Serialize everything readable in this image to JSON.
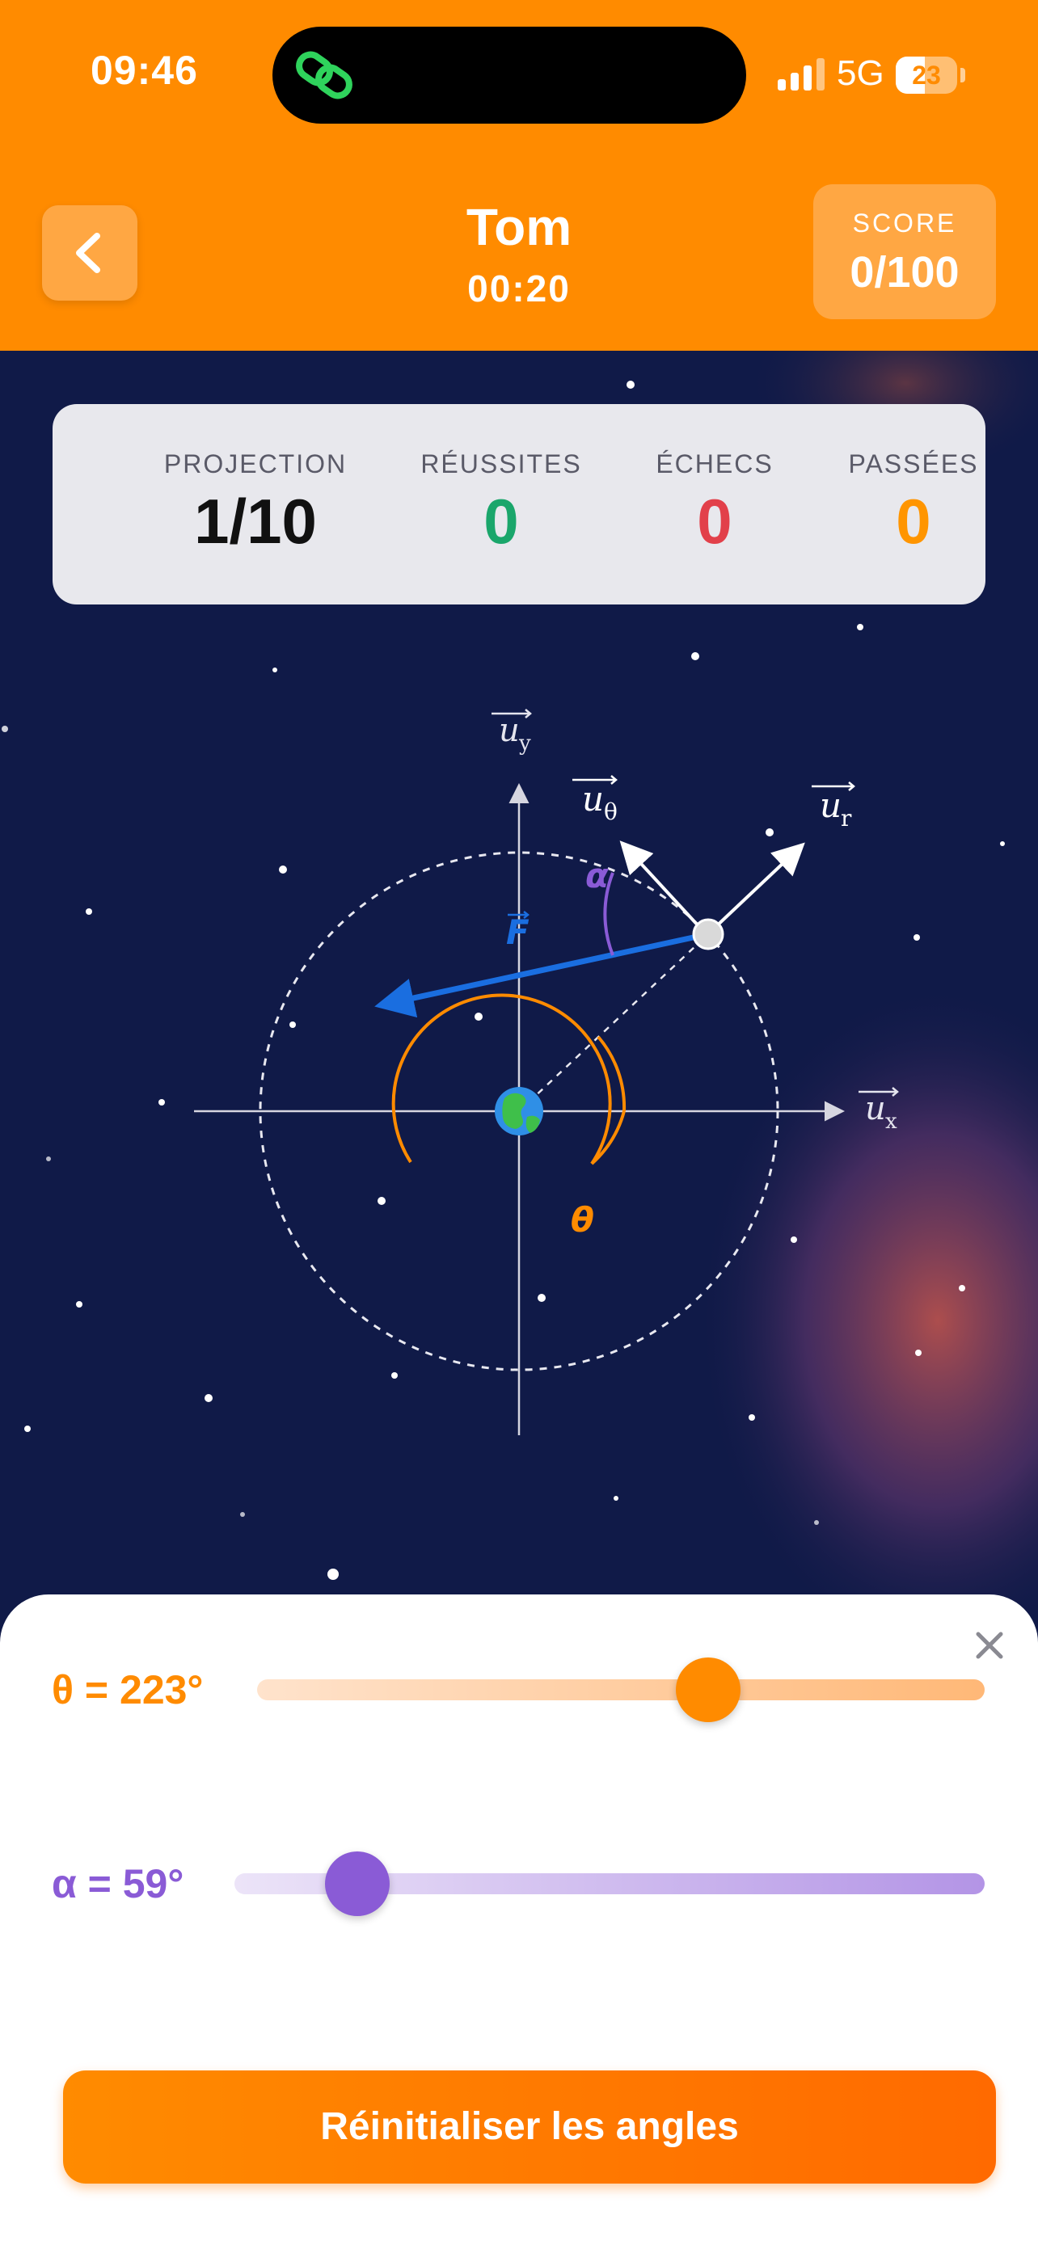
{
  "status_bar": {
    "time": "09:46",
    "network": "5G",
    "battery": "23"
  },
  "header": {
    "player_name": "Tom",
    "timer": "00:20",
    "score_label": "SCORE",
    "score_value": "0/100"
  },
  "stats": [
    {
      "label": "PROJECTION",
      "value": "1/10",
      "color": "#111111"
    },
    {
      "label": "RÉUSSITES",
      "value": "0",
      "color": "#1aa66b"
    },
    {
      "label": "ÉCHECS",
      "value": "0",
      "color": "#e2404a"
    },
    {
      "label": "PASSÉES",
      "value": "0",
      "color": "#ff9500"
    }
  ],
  "diagram": {
    "axis_x": "u",
    "axis_x_sub": "x",
    "axis_y": "u",
    "axis_y_sub": "y",
    "vec_r": "u",
    "vec_r_sub": "r",
    "vec_theta": "u",
    "vec_theta_sub": "θ",
    "force": "F",
    "angle_theta": "θ",
    "angle_alpha": "α",
    "earth_icon": "earth-icon"
  },
  "controls": {
    "theta_label": "θ = 223°",
    "theta_value": 223,
    "theta_max": 360,
    "alpha_label": "α = 59°",
    "alpha_value": 59,
    "alpha_max": 360,
    "theta_color": "#ff8b00",
    "alpha_color": "#8a5bd6",
    "reset_label": "Réinitialiser les angles"
  }
}
